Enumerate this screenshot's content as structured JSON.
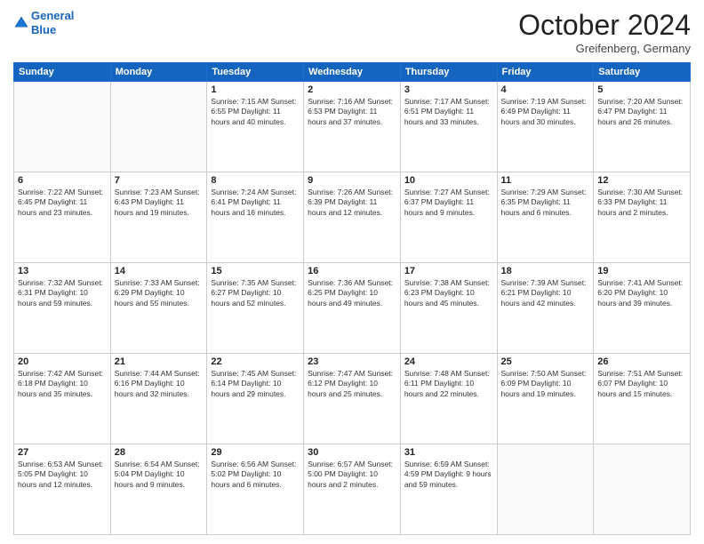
{
  "header": {
    "logo_line1": "General",
    "logo_line2": "Blue",
    "month_title": "October 2024",
    "location": "Greifenberg, Germany"
  },
  "days_of_week": [
    "Sunday",
    "Monday",
    "Tuesday",
    "Wednesday",
    "Thursday",
    "Friday",
    "Saturday"
  ],
  "weeks": [
    [
      {
        "day": "",
        "info": ""
      },
      {
        "day": "",
        "info": ""
      },
      {
        "day": "1",
        "info": "Sunrise: 7:15 AM\nSunset: 6:55 PM\nDaylight: 11 hours and 40 minutes."
      },
      {
        "day": "2",
        "info": "Sunrise: 7:16 AM\nSunset: 6:53 PM\nDaylight: 11 hours and 37 minutes."
      },
      {
        "day": "3",
        "info": "Sunrise: 7:17 AM\nSunset: 6:51 PM\nDaylight: 11 hours and 33 minutes."
      },
      {
        "day": "4",
        "info": "Sunrise: 7:19 AM\nSunset: 6:49 PM\nDaylight: 11 hours and 30 minutes."
      },
      {
        "day": "5",
        "info": "Sunrise: 7:20 AM\nSunset: 6:47 PM\nDaylight: 11 hours and 26 minutes."
      }
    ],
    [
      {
        "day": "6",
        "info": "Sunrise: 7:22 AM\nSunset: 6:45 PM\nDaylight: 11 hours and 23 minutes."
      },
      {
        "day": "7",
        "info": "Sunrise: 7:23 AM\nSunset: 6:43 PM\nDaylight: 11 hours and 19 minutes."
      },
      {
        "day": "8",
        "info": "Sunrise: 7:24 AM\nSunset: 6:41 PM\nDaylight: 11 hours and 16 minutes."
      },
      {
        "day": "9",
        "info": "Sunrise: 7:26 AM\nSunset: 6:39 PM\nDaylight: 11 hours and 12 minutes."
      },
      {
        "day": "10",
        "info": "Sunrise: 7:27 AM\nSunset: 6:37 PM\nDaylight: 11 hours and 9 minutes."
      },
      {
        "day": "11",
        "info": "Sunrise: 7:29 AM\nSunset: 6:35 PM\nDaylight: 11 hours and 6 minutes."
      },
      {
        "day": "12",
        "info": "Sunrise: 7:30 AM\nSunset: 6:33 PM\nDaylight: 11 hours and 2 minutes."
      }
    ],
    [
      {
        "day": "13",
        "info": "Sunrise: 7:32 AM\nSunset: 6:31 PM\nDaylight: 10 hours and 59 minutes."
      },
      {
        "day": "14",
        "info": "Sunrise: 7:33 AM\nSunset: 6:29 PM\nDaylight: 10 hours and 55 minutes."
      },
      {
        "day": "15",
        "info": "Sunrise: 7:35 AM\nSunset: 6:27 PM\nDaylight: 10 hours and 52 minutes."
      },
      {
        "day": "16",
        "info": "Sunrise: 7:36 AM\nSunset: 6:25 PM\nDaylight: 10 hours and 49 minutes."
      },
      {
        "day": "17",
        "info": "Sunrise: 7:38 AM\nSunset: 6:23 PM\nDaylight: 10 hours and 45 minutes."
      },
      {
        "day": "18",
        "info": "Sunrise: 7:39 AM\nSunset: 6:21 PM\nDaylight: 10 hours and 42 minutes."
      },
      {
        "day": "19",
        "info": "Sunrise: 7:41 AM\nSunset: 6:20 PM\nDaylight: 10 hours and 39 minutes."
      }
    ],
    [
      {
        "day": "20",
        "info": "Sunrise: 7:42 AM\nSunset: 6:18 PM\nDaylight: 10 hours and 35 minutes."
      },
      {
        "day": "21",
        "info": "Sunrise: 7:44 AM\nSunset: 6:16 PM\nDaylight: 10 hours and 32 minutes."
      },
      {
        "day": "22",
        "info": "Sunrise: 7:45 AM\nSunset: 6:14 PM\nDaylight: 10 hours and 29 minutes."
      },
      {
        "day": "23",
        "info": "Sunrise: 7:47 AM\nSunset: 6:12 PM\nDaylight: 10 hours and 25 minutes."
      },
      {
        "day": "24",
        "info": "Sunrise: 7:48 AM\nSunset: 6:11 PM\nDaylight: 10 hours and 22 minutes."
      },
      {
        "day": "25",
        "info": "Sunrise: 7:50 AM\nSunset: 6:09 PM\nDaylight: 10 hours and 19 minutes."
      },
      {
        "day": "26",
        "info": "Sunrise: 7:51 AM\nSunset: 6:07 PM\nDaylight: 10 hours and 15 minutes."
      }
    ],
    [
      {
        "day": "27",
        "info": "Sunrise: 6:53 AM\nSunset: 5:05 PM\nDaylight: 10 hours and 12 minutes."
      },
      {
        "day": "28",
        "info": "Sunrise: 6:54 AM\nSunset: 5:04 PM\nDaylight: 10 hours and 9 minutes."
      },
      {
        "day": "29",
        "info": "Sunrise: 6:56 AM\nSunset: 5:02 PM\nDaylight: 10 hours and 6 minutes."
      },
      {
        "day": "30",
        "info": "Sunrise: 6:57 AM\nSunset: 5:00 PM\nDaylight: 10 hours and 2 minutes."
      },
      {
        "day": "31",
        "info": "Sunrise: 6:59 AM\nSunset: 4:59 PM\nDaylight: 9 hours and 59 minutes."
      },
      {
        "day": "",
        "info": ""
      },
      {
        "day": "",
        "info": ""
      }
    ]
  ]
}
